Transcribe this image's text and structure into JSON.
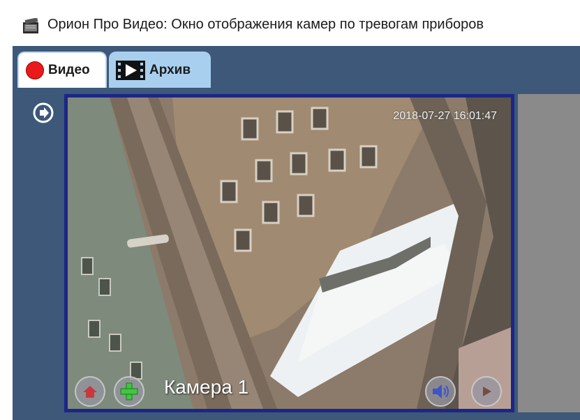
{
  "window": {
    "title": "Орион Про Видео: Окно отображения камер по тревогам приборов"
  },
  "tabs": [
    {
      "label": "Видео",
      "icon": "record-dot-icon",
      "active": true
    },
    {
      "label": "Архив",
      "icon": "film-strip-icon",
      "active": false
    }
  ],
  "sidebar": {
    "toggle_icon": "arrow-right-circle-icon"
  },
  "camera": {
    "timestamp": "2018-07-27 16:01:47",
    "name": "Камера 1",
    "controls": [
      "ptz-home-icon",
      "add-icon",
      "speaker-icon",
      "play-icon"
    ]
  },
  "colors": {
    "frame": "#3d5879",
    "cell_border": "#1c2686",
    "active_tab": "#ffffff",
    "inactive_tab": "#a9cfee",
    "record": "#ea1a1a",
    "add": "#3ec83e"
  }
}
